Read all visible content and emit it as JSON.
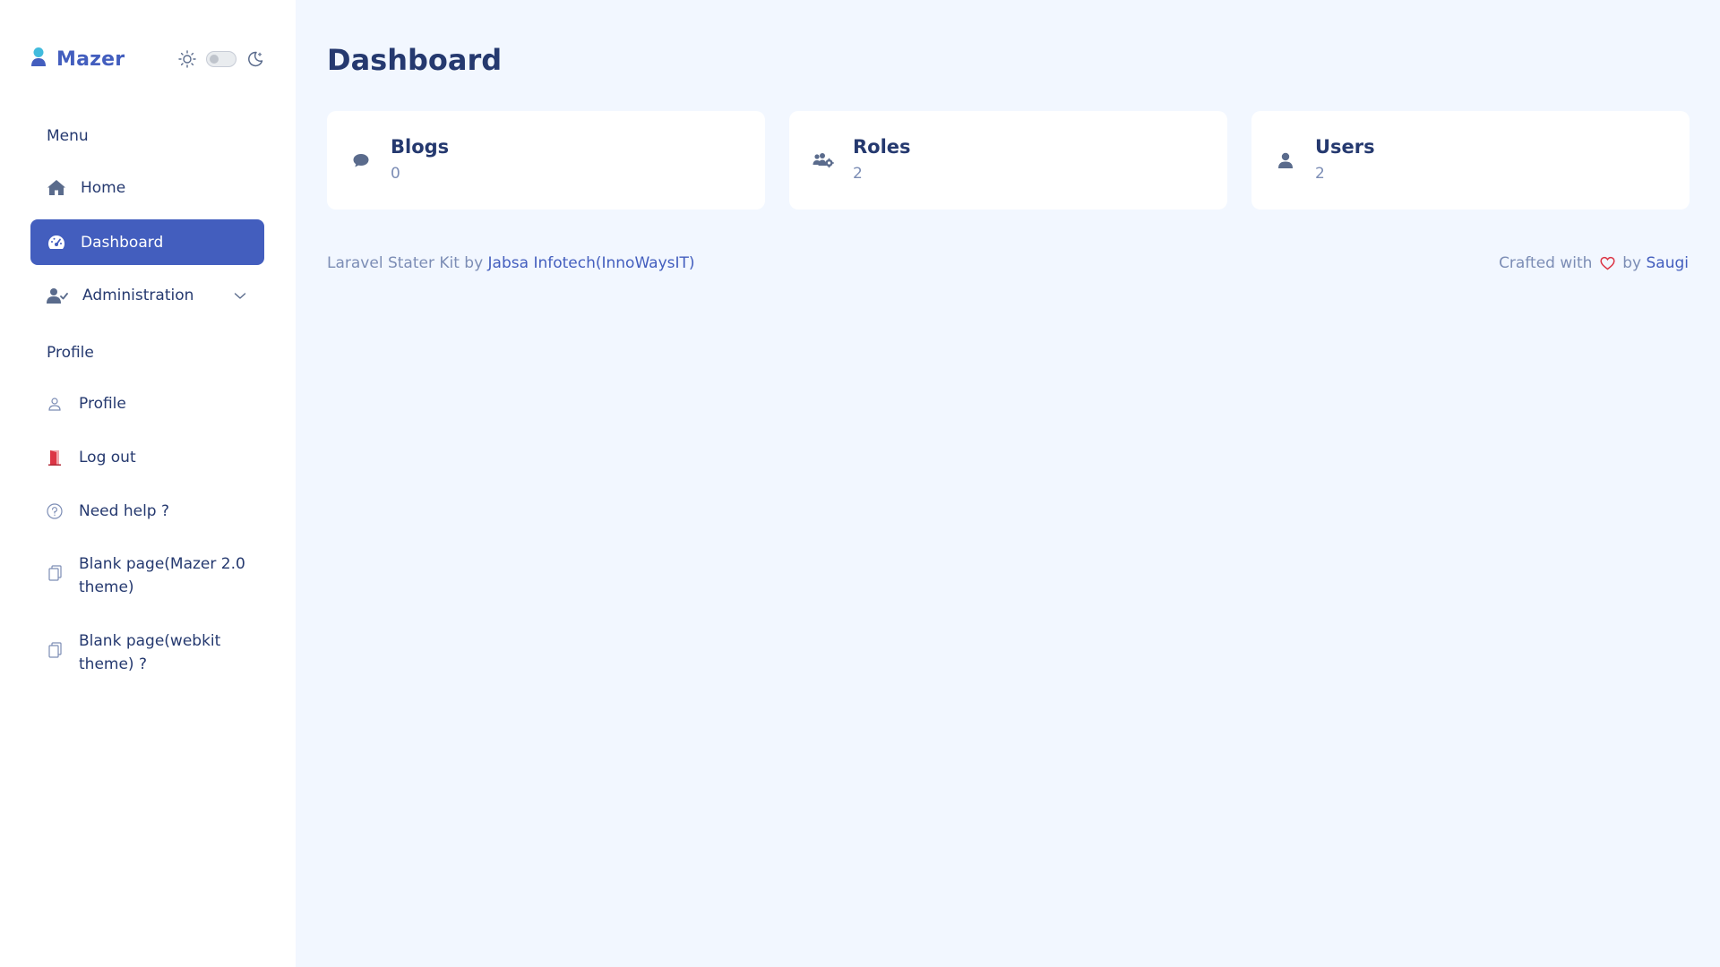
{
  "brand": {
    "name": "Mazer"
  },
  "sidebar": {
    "sections": [
      {
        "title": "Menu"
      },
      {
        "title": "Profile"
      }
    ],
    "items": [
      {
        "label": "Home",
        "icon": "home-icon"
      },
      {
        "label": "Dashboard",
        "icon": "speedometer-icon",
        "active": true
      },
      {
        "label": "Administration",
        "icon": "user-check-icon",
        "has_submenu": true
      },
      {
        "label": "Profile",
        "icon": "person-icon"
      },
      {
        "label": "Log out",
        "icon": "door-icon"
      },
      {
        "label": "Need help ?",
        "icon": "question-circle-icon"
      },
      {
        "label": "Blank page(Mazer 2.0 theme)",
        "icon": "copy-icon"
      },
      {
        "label": "Blank page(webkit theme) ?",
        "icon": "copy-icon"
      }
    ]
  },
  "main": {
    "title": "Dashboard",
    "cards": [
      {
        "title": "Blogs",
        "value": "0",
        "icon": "comment-icon"
      },
      {
        "title": "Roles",
        "value": "2",
        "icon": "users-gear-icon"
      },
      {
        "title": "Users",
        "value": "2",
        "icon": "user-icon"
      }
    ]
  },
  "footer": {
    "left_text": "Laravel Stater Kit by",
    "left_link": "Jabsa Infotech(InnoWaysIT)",
    "right_text_1": "Crafted with",
    "right_text_2": "by",
    "right_link": "Saugi"
  },
  "colors": {
    "primary": "#435ebe",
    "text": "#25396f",
    "muted": "#7c8db5",
    "background": "#f2f7ff",
    "logout_icon": "#dc3545",
    "heart": "#dc3545"
  }
}
